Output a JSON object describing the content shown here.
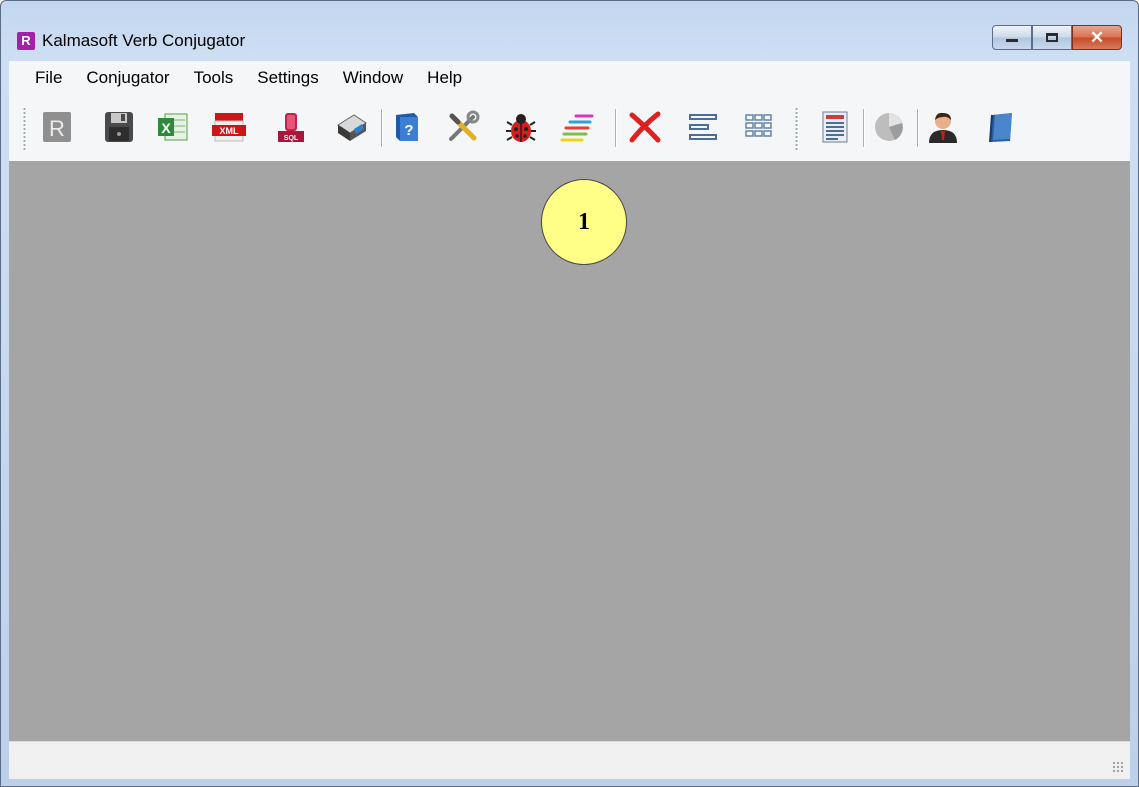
{
  "window": {
    "title": "Kalmasoft Verb Conjugator",
    "app_icon_letter": "R"
  },
  "caption_buttons": {
    "minimize": "minimize",
    "maximize": "maximize",
    "close": "✕"
  },
  "menu": [
    "File",
    "Conjugator",
    "Tools",
    "Settings",
    "Window",
    "Help"
  ],
  "toolbar": {
    "icons": [
      "r-logo-icon",
      "save-floppy-icon",
      "excel-export-icon",
      "xml-export-icon",
      "sql-export-icon",
      "print-icon",
      "help-book-icon",
      "tools-icon",
      "bug-report-icon",
      "color-lines-icon",
      "delete-x-icon",
      "align-left-icon",
      "grid-view-icon",
      "report-icon",
      "pie-chart-icon",
      "user-icon",
      "book-icon"
    ],
    "xml_badge": "XML",
    "sql_badge": "SQL",
    "excel_badge": "X"
  },
  "annotation": {
    "marker_label": "1"
  },
  "colors": {
    "client_bg": "#a5a5a5",
    "marker_fill": "#ffff88",
    "app_icon": "#a61fa8"
  }
}
